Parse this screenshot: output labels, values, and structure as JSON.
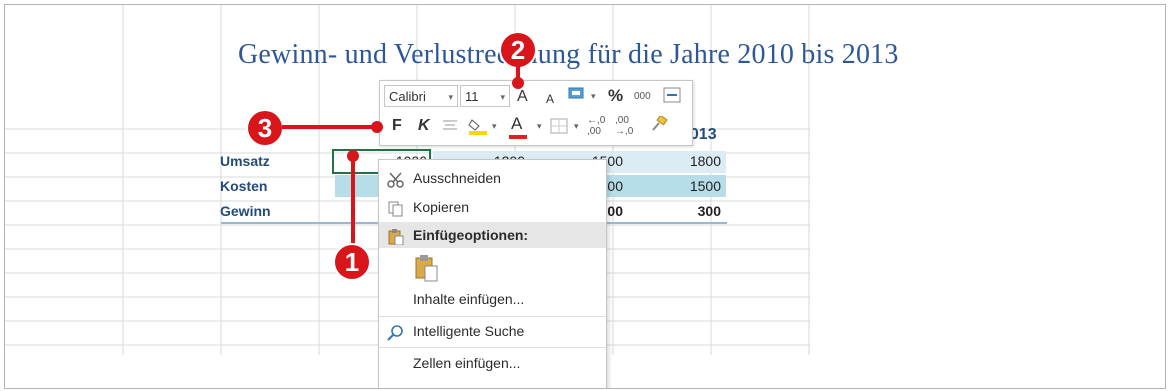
{
  "sheet": {
    "title": "Gewinn- und Verlustrechnung für die Jahre 2010 bis 2013",
    "year_header_partial": "2013",
    "rows": [
      {
        "label": "Umsatz",
        "c1": "1000",
        "c2": "1200",
        "c3": "1500",
        "c4": "1800"
      },
      {
        "label": "Kosten",
        "c3": "00",
        "c4": "1500"
      },
      {
        "label": "Gewinn",
        "c3": "00",
        "c4": "300"
      }
    ],
    "accent": "#2e5797",
    "selection_color": "#217346"
  },
  "mini_toolbar": {
    "font_name": "Calibri",
    "font_size": "11",
    "grow_font": "A",
    "shrink_font": "A",
    "percent": "%",
    "thousands": "000",
    "bold": "F",
    "italic": "K",
    "font_color": "A",
    "inc_decimal": ",00",
    "dec_decimal": ",00"
  },
  "context_menu": {
    "items": [
      {
        "label": "Ausschneiden",
        "icon": "scissors-icon"
      },
      {
        "label": "Kopieren",
        "icon": "copy-icon"
      },
      {
        "label": "Einfügeoptionen:",
        "icon": "paste-icon"
      },
      {
        "label": "Inhalte einfügen...",
        "icon": ""
      },
      {
        "label": "Intelligente Suche",
        "icon": "search-icon"
      },
      {
        "label": "Zellen einfügen...",
        "icon": ""
      }
    ]
  },
  "callouts": [
    {
      "number": "1",
      "color": "#d9151c"
    },
    {
      "number": "2",
      "color": "#d9151c"
    },
    {
      "number": "3",
      "color": "#d9151c"
    }
  ]
}
